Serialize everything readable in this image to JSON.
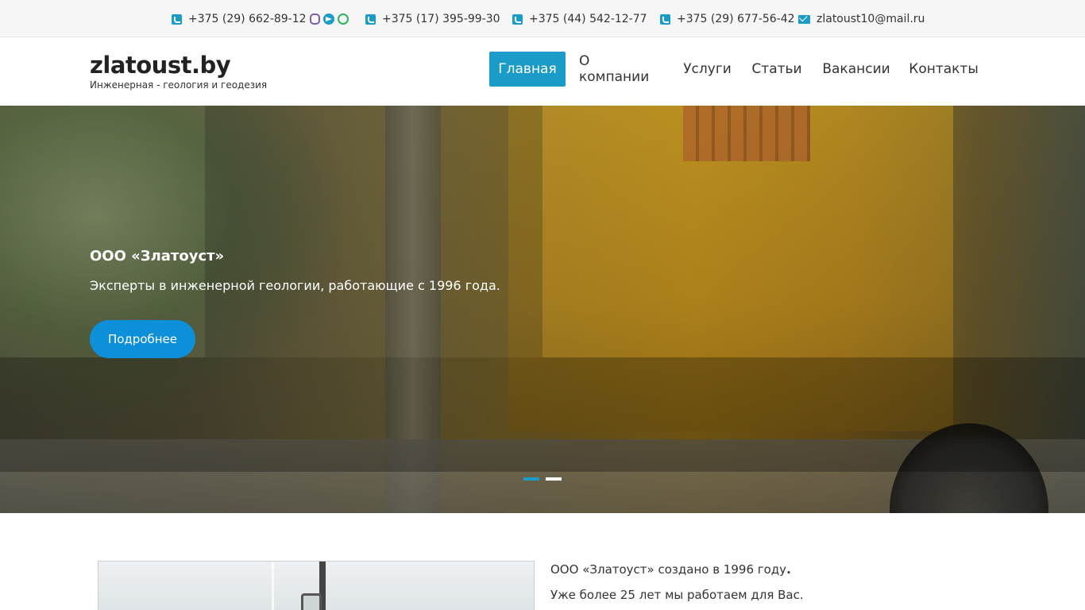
{
  "topbar": {
    "contacts": [
      {
        "icon": "phone-icon",
        "text": "+375 (29) 662-89-12",
        "messengers": [
          "viber-icon",
          "telegram-icon",
          "whatsapp-icon"
        ]
      },
      {
        "icon": "phone-icon",
        "text": "+375 (17) 395-99-30"
      },
      {
        "icon": "phone-icon",
        "text": "+375 (44) 542-12-77"
      },
      {
        "icon": "phone-icon",
        "text": "+375 (29) 677-56-42"
      },
      {
        "icon": "mail-icon",
        "text": "zlatoust10@mail.ru"
      }
    ]
  },
  "header": {
    "brand": "zlatoust.by",
    "tagline": "Инженерная - геология и геодезия",
    "nav": [
      {
        "label": "Главная",
        "active": true
      },
      {
        "label": "О компании",
        "active": false
      },
      {
        "label": "Услуги",
        "active": false
      },
      {
        "label": "Статьи",
        "active": false
      },
      {
        "label": "Вакансии",
        "active": false
      },
      {
        "label": "Контакты",
        "active": false
      }
    ]
  },
  "hero": {
    "title": "ООО «Златоуст»",
    "text": "Эксперты в инженерной геологии, работающие с 1996 года.",
    "button": "Подробнее",
    "slides_count": 2,
    "active_slide": 1
  },
  "about": {
    "line1": "ООО «Златоуст» создано в 1996 году",
    "line1_end": ".",
    "line2": "Уже более 25 лет мы работаем для Вас."
  },
  "colors": {
    "accent": "#1b9bc7",
    "button": "#0d8fd9",
    "topbar_bg": "#f6f6f6"
  }
}
